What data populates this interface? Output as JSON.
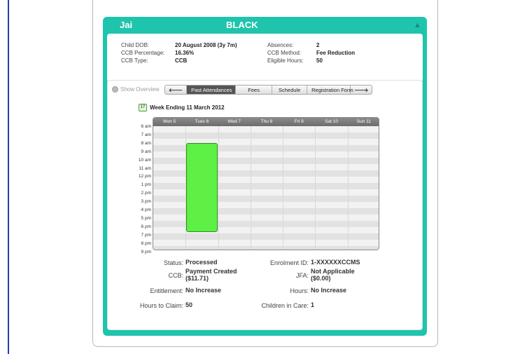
{
  "child": {
    "first_name": "Jai",
    "last_name": "BLACK"
  },
  "info": {
    "dob_label": "Child DOB:",
    "dob": "20 August 2008 (3y 7m)",
    "ccb_pct_label": "CCB Percentage:",
    "ccb_pct": "16.36%",
    "ccb_type_label": "CCB Type:",
    "ccb_type": "CCB",
    "absences_label": "Absences:",
    "absences": "2",
    "ccb_method_label": "CCB Method:",
    "ccb_method": "Fee Reduction",
    "eligible_label": "Eligible Hours:",
    "eligible": "50"
  },
  "toolbar": {
    "show_overview": "Show Overview",
    "prev_arrow": "🡐",
    "tabs": [
      "Past Attendances",
      "Fees",
      "Schedule",
      "Registration Form"
    ],
    "next_arrow": "🡒",
    "active_tab": "Past Attendances"
  },
  "week": {
    "label": "Week Ending 11 March 2012",
    "icon_text": "17"
  },
  "days": [
    "Mon 5",
    "Tues 6",
    "Wed 7",
    "Thu 8",
    "Fri 9",
    "Sat 10",
    "Sun 11"
  ],
  "hours": [
    "6 am",
    "7 am",
    "8 am",
    "9 am",
    "10 am",
    "11 am",
    "12 pm",
    "1 pm",
    "2 pm",
    "3 pm",
    "4 pm",
    "5 pm",
    "6 pm",
    "7 pm",
    "8 pm",
    "9 pm"
  ],
  "attendance": [
    {
      "day_index": 1,
      "start_hour": 8.5,
      "end_hour": 19.0
    }
  ],
  "summary": {
    "status_label": "Status:",
    "status": "Processed",
    "enrol_label": "Enrolment ID:",
    "enrol": "1-XXXXXXCCMS",
    "ccb_label": "CCB:",
    "ccb_line1": "Payment Created",
    "ccb_line2": "($11.71)",
    "jfa_label": "JFA:",
    "jfa_line1": "Not Applicable",
    "jfa_line2": "($0.00)",
    "entitlement_label": "Entitlement:",
    "entitlement": "No Increase",
    "hours_label": "Hours:",
    "hours": "No Increase",
    "claim_label": "Hours to Claim:",
    "claim": "50",
    "children_label": "Children in Care:",
    "children": "1"
  },
  "colors": {
    "accent": "#1fc4ac",
    "attendance": "#5ef044",
    "tab_active": "#555555",
    "left_bar": "#1f3fa8"
  }
}
